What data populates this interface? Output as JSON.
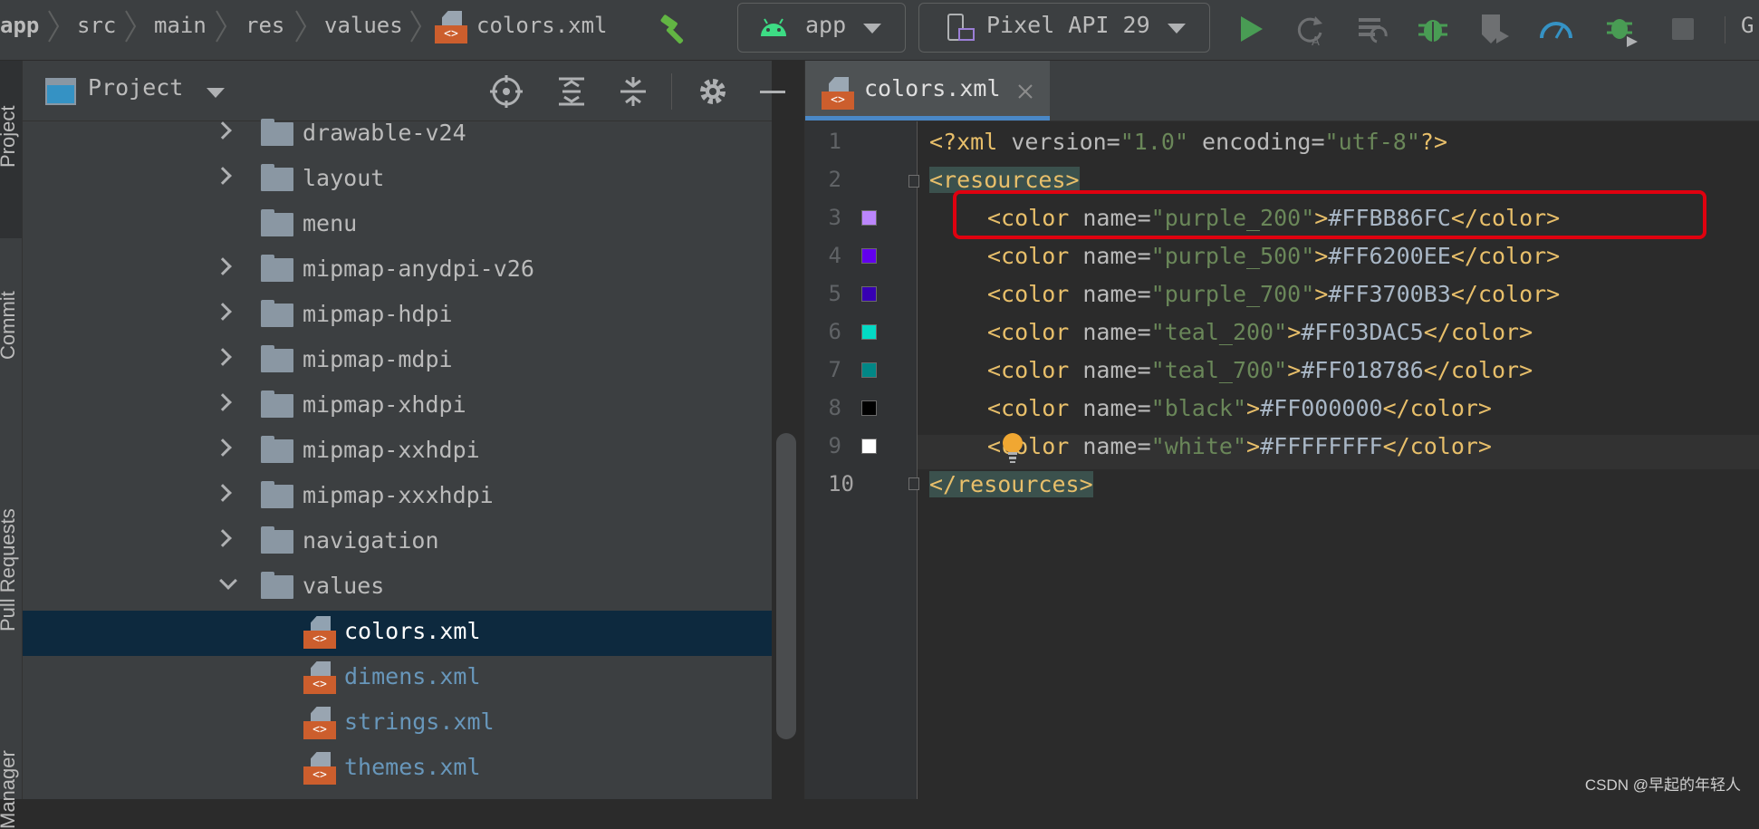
{
  "breadcrumbs": [
    "app",
    "src",
    "main",
    "res",
    "values",
    "colors.xml"
  ],
  "toolbar": {
    "run_config": "app",
    "device": "Pixel API 29",
    "icons": [
      "hammer-icon",
      "run-icon",
      "apply-changes-icon",
      "apply-code-changes-icon",
      "debug-icon",
      "coverage-icon",
      "profile-icon",
      "attach-debugger-icon",
      "stop-icon"
    ],
    "overflow_text": "G"
  },
  "side_tabs": [
    "Project",
    "Commit",
    "Pull Requests",
    "Manager"
  ],
  "project_panel": {
    "title": "Project",
    "tree": [
      {
        "name": "drawable-v24",
        "type": "folder",
        "expand": "collapsed"
      },
      {
        "name": "layout",
        "type": "folder",
        "expand": "collapsed"
      },
      {
        "name": "menu",
        "type": "folder",
        "expand": "none"
      },
      {
        "name": "mipmap-anydpi-v26",
        "type": "folder",
        "expand": "collapsed"
      },
      {
        "name": "mipmap-hdpi",
        "type": "folder",
        "expand": "collapsed"
      },
      {
        "name": "mipmap-mdpi",
        "type": "folder",
        "expand": "collapsed"
      },
      {
        "name": "mipmap-xhdpi",
        "type": "folder",
        "expand": "collapsed"
      },
      {
        "name": "mipmap-xxhdpi",
        "type": "folder",
        "expand": "collapsed"
      },
      {
        "name": "mipmap-xxxhdpi",
        "type": "folder",
        "expand": "collapsed"
      },
      {
        "name": "navigation",
        "type": "folder",
        "expand": "collapsed"
      },
      {
        "name": "values",
        "type": "folder",
        "expand": "expanded"
      },
      {
        "name": "colors.xml",
        "type": "xml",
        "state": "selected"
      },
      {
        "name": "dimens.xml",
        "type": "xml",
        "state": "modified"
      },
      {
        "name": "strings.xml",
        "type": "xml",
        "state": "modified"
      },
      {
        "name": "themes.xml",
        "type": "xml",
        "state": "modified"
      }
    ]
  },
  "editor": {
    "tab_label": "colors.xml",
    "line_numbers": [
      "1",
      "2",
      "3",
      "4",
      "5",
      "6",
      "7",
      "8",
      "9",
      "10"
    ],
    "prolog": {
      "open": "<?xml ",
      "attr1": "version",
      "eq": "=",
      "val1": "\"1.0\"",
      "attr2": " encoding",
      "val2": "\"utf-8\"",
      "close": "?>"
    },
    "open_root": "<resources>",
    "close_root": "</resources>",
    "colors": [
      {
        "name": "purple_200",
        "value": "#FFBB86FC",
        "swatch": "#BB86FC"
      },
      {
        "name": "purple_500",
        "value": "#FF6200EE",
        "swatch": "#6200EE"
      },
      {
        "name": "purple_700",
        "value": "#FF3700B3",
        "swatch": "#3700B3"
      },
      {
        "name": "teal_200",
        "value": "#FF03DAC5",
        "swatch": "#03DAC5"
      },
      {
        "name": "teal_700",
        "value": "#FF018786",
        "swatch": "#018786"
      },
      {
        "name": "black",
        "value": "#FF000000",
        "swatch": "#000000"
      },
      {
        "name": "white",
        "value": "#FFFFFFFF",
        "swatch": "#FFFFFF"
      }
    ],
    "tag_open": "<color",
    "attr_name": " name",
    "eq": "=",
    "tag_gt": ">",
    "tag_close": "</color>"
  },
  "watermark": "CSDN @早起的年轻人",
  "colors": {
    "highlight": "#e0000f",
    "selection": "#0d293e",
    "accent": "#4a88c7"
  }
}
